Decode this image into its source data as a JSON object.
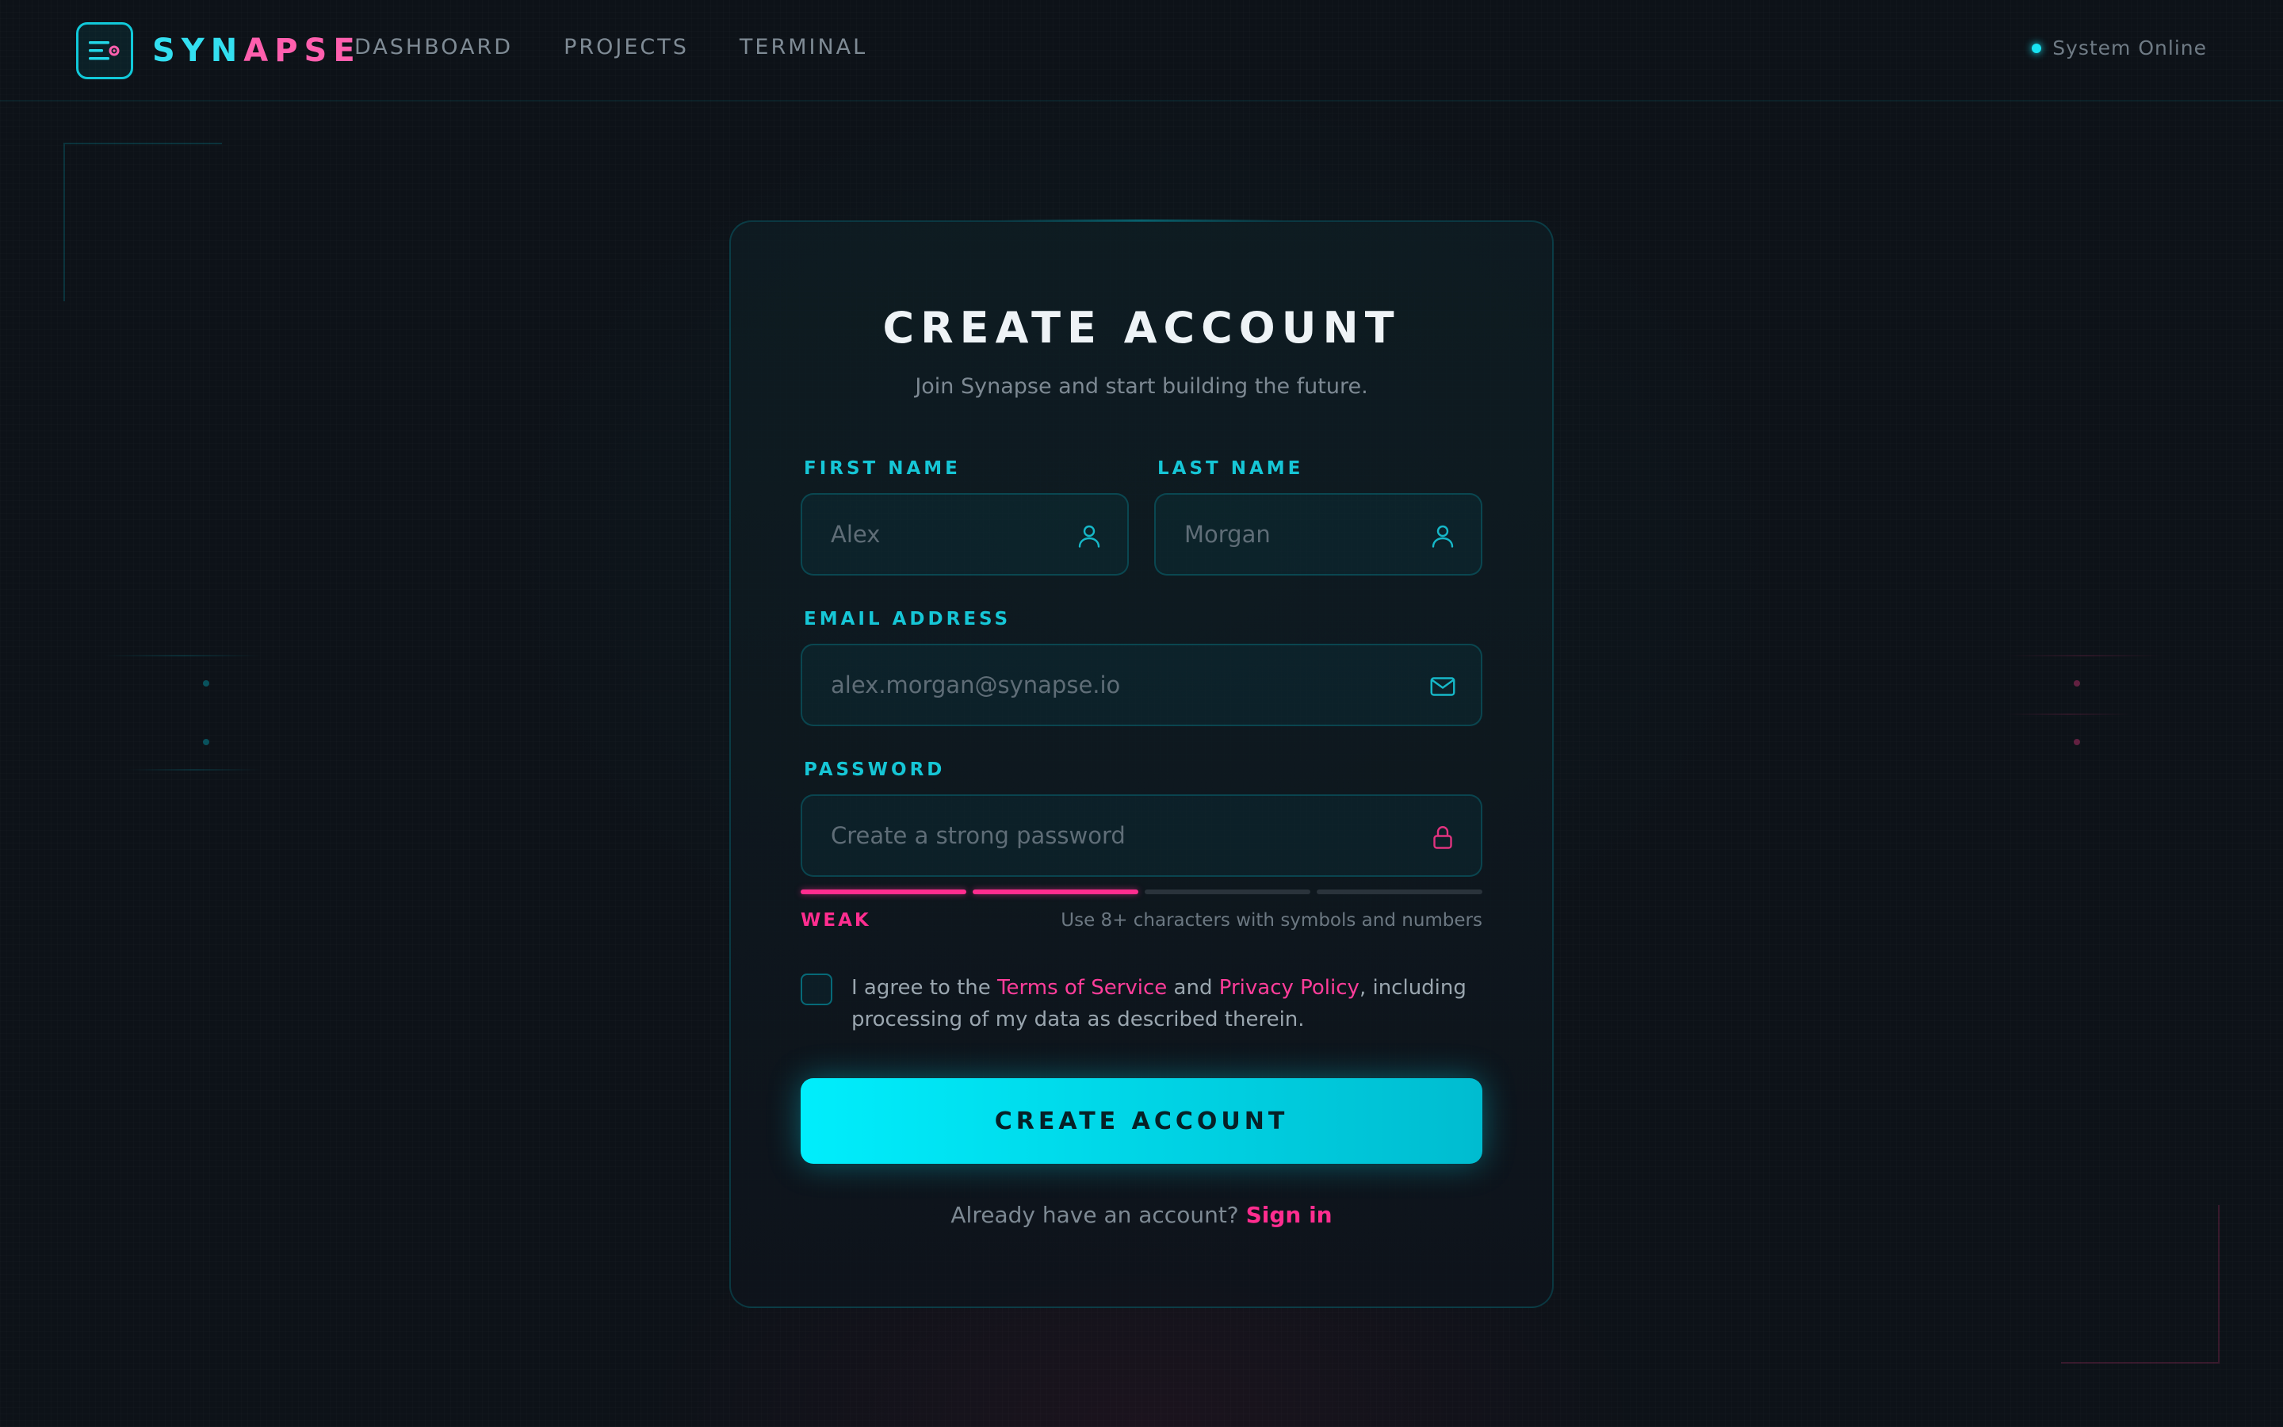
{
  "header": {
    "brand_part1": "SYN",
    "brand_part2": "APSE",
    "nav": [
      "DASHBOARD",
      "PROJECTS",
      "TERMINAL"
    ],
    "status": "System Online"
  },
  "form": {
    "title": "CREATE ACCOUNT",
    "subtitle": "Join Synapse and start building the future.",
    "first_name": {
      "label": "FIRST NAME",
      "placeholder": "Alex",
      "value": ""
    },
    "last_name": {
      "label": "LAST NAME",
      "placeholder": "Morgan",
      "value": ""
    },
    "email": {
      "label": "EMAIL ADDRESS",
      "placeholder": "alex.morgan@synapse.io",
      "value": ""
    },
    "password": {
      "label": "PASSWORD",
      "placeholder": "Create a strong password",
      "value": ""
    },
    "strength": {
      "level": 2,
      "total": 4,
      "label": "WEAK",
      "hint": "Use 8+ characters with symbols and numbers"
    },
    "agree": {
      "checked": false,
      "prefix": "I agree to the ",
      "terms": "Terms of Service",
      "and": " and ",
      "privacy": "Privacy Policy",
      "suffix": ", including processing of my data as described therein."
    },
    "submit_label": "CREATE ACCOUNT",
    "signin_prompt": "Already have an account?",
    "signin_link": "Sign in"
  },
  "colors": {
    "accent_cyan": "#00eefc",
    "accent_pink": "#ff2d8f",
    "background": "#0d1218"
  },
  "icons": {
    "logo": "menu-lines-icon",
    "first_name": "user-icon",
    "last_name": "user-icon",
    "email": "mail-icon",
    "password": "lock-icon"
  }
}
